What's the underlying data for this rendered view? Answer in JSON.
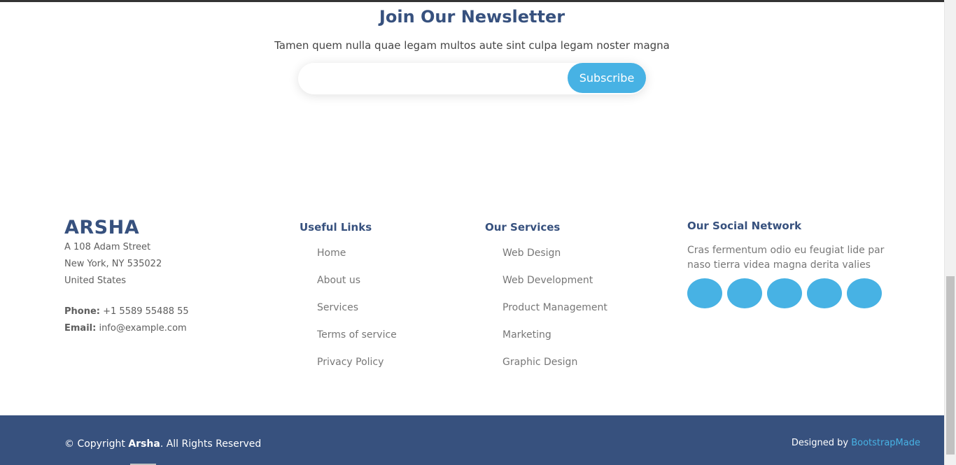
{
  "newsletter": {
    "title": "Join Our Newsletter",
    "description": "Tamen quem nulla quae legam multos aute sint culpa legam noster magna",
    "input_placeholder": "",
    "subscribe_label": "Subscribe"
  },
  "footer": {
    "brand": "ARSHA",
    "address": [
      "A 108 Adam Street",
      "New York, NY 535022",
      "United States"
    ],
    "phone_label": "Phone:",
    "phone": "+1 5589 55488 55",
    "email_label": "Email:",
    "email": "info@example.com",
    "useful_links": {
      "title": "Useful Links",
      "items": [
        "Home",
        "About us",
        "Services",
        "Terms of service",
        "Privacy Policy"
      ]
    },
    "services": {
      "title": "Our Services",
      "items": [
        "Web Design",
        "Web Development",
        "Product Management",
        "Marketing",
        "Graphic Design"
      ]
    },
    "social": {
      "title": "Our Social Network",
      "description": "Cras fermentum odio eu feugiat lide par naso tierra videa magna derita valies",
      "icons": [
        "twitter-icon",
        "facebook-icon",
        "instagram-icon",
        "skype-icon",
        "linkedin-icon"
      ]
    },
    "copyright_prefix": "© Copyright",
    "copyright_brand": "Arsha",
    "copyright_suffix": ". All Rights Reserved",
    "credits_prefix": "Designed by",
    "credits_link": "BootstrapMade"
  },
  "colors": {
    "accent": "#47b2e4",
    "brand": "#37517e"
  }
}
